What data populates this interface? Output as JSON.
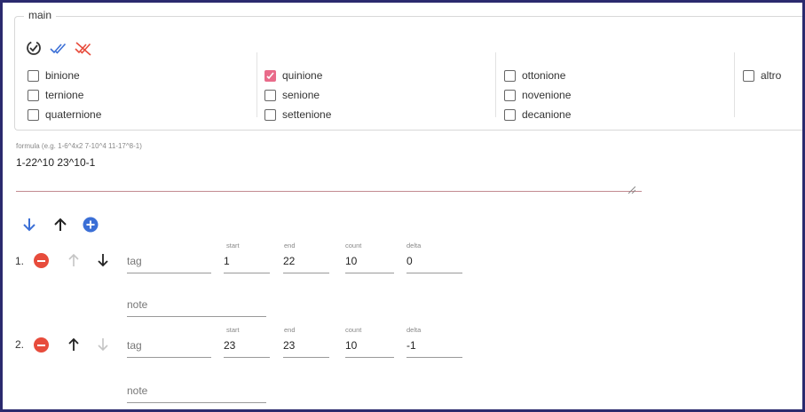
{
  "main": {
    "legend": "main",
    "toolbar_icons": [
      "cycle-icon",
      "check-all-icon",
      "uncheck-all-icon"
    ],
    "columns": [
      [
        {
          "label": "binione",
          "checked": false
        },
        {
          "label": "ternione",
          "checked": false
        },
        {
          "label": "quaternione",
          "checked": false
        }
      ],
      [
        {
          "label": "quinione",
          "checked": true
        },
        {
          "label": "senione",
          "checked": false
        },
        {
          "label": "settenione",
          "checked": false
        }
      ],
      [
        {
          "label": "ottonione",
          "checked": false
        },
        {
          "label": "novenione",
          "checked": false
        },
        {
          "label": "decanione",
          "checked": false
        }
      ],
      [
        {
          "label": "altro",
          "checked": false
        }
      ]
    ]
  },
  "formula": {
    "label": "formula (e.g. 1-6^4x2 7-10^4 11-17^8-1)",
    "value": "1-22^10 23^10-1"
  },
  "list_toolbar": [
    "arrow-down-icon",
    "arrow-up-icon",
    "add-circle-icon"
  ],
  "ranges": [
    {
      "number": "1.",
      "tag_placeholder": "tag",
      "start_label": "start",
      "start": "1",
      "end_label": "end",
      "end": "22",
      "count_label": "count",
      "count": "10",
      "delta_label": "delta",
      "delta": "0",
      "note_placeholder": "note",
      "up_enabled": false,
      "down_enabled": true
    },
    {
      "number": "2.",
      "tag_placeholder": "tag",
      "start_label": "start",
      "start": "23",
      "end_label": "end",
      "end": "23",
      "count_label": "count",
      "count": "10",
      "delta_label": "delta",
      "delta": "-1",
      "note_placeholder": "note",
      "up_enabled": true,
      "down_enabled": false
    }
  ],
  "colors": {
    "accent_blue": "#3b6fd6",
    "danger_red": "#e74c3c",
    "checked_pink": "#e96b8a",
    "frame": "#2b2a6e"
  }
}
